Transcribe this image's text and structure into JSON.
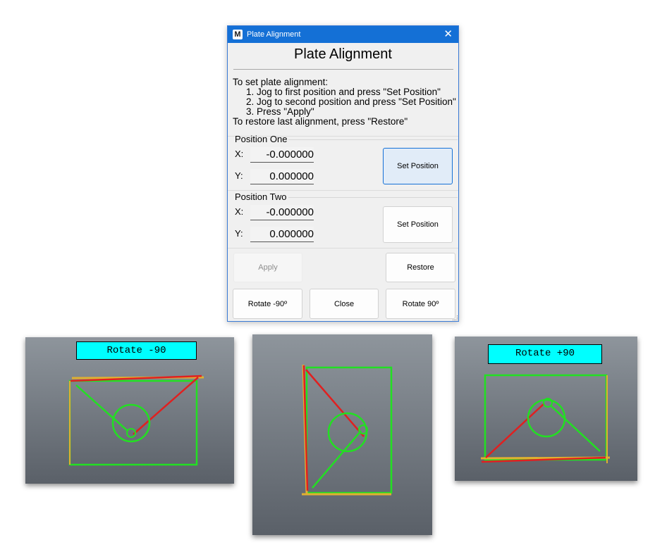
{
  "window": {
    "title": "Plate Alignment",
    "logo": "M",
    "close_glyph": "✕"
  },
  "heading": "Plate Alignment",
  "instructions": {
    "intro": "To set plate alignment:",
    "step1": "1. Jog to first position and press \"Set Position\"",
    "step2": "2. Jog to second position and press \"Set Position\"",
    "step3": "3. Press \"Apply\"",
    "restore": "To restore last alignment, press \"Restore\""
  },
  "position_one": {
    "title": "Position One",
    "x_label": "X:",
    "x_value": "-0.000000",
    "y_label": "Y:",
    "y_value": "0.000000",
    "button": "Set Position"
  },
  "position_two": {
    "title": "Position Two",
    "x_label": "X:",
    "x_value": "-0.000000",
    "y_label": "Y:",
    "y_value": "0.000000",
    "button": "Set Position"
  },
  "buttons": {
    "apply": "Apply",
    "restore": "Restore",
    "rotate_minus": "Rotate -90º",
    "close": "Close",
    "rotate_plus": "Rotate 90º"
  },
  "previews": {
    "left_label": "Rotate -90",
    "right_label": "Rotate +90"
  },
  "colors": {
    "title_bar": "#1470d6",
    "outline_green": "#22e022",
    "align_red": "#e02020",
    "edge_orange": "#e0b030",
    "label_bg": "#00ffff"
  }
}
